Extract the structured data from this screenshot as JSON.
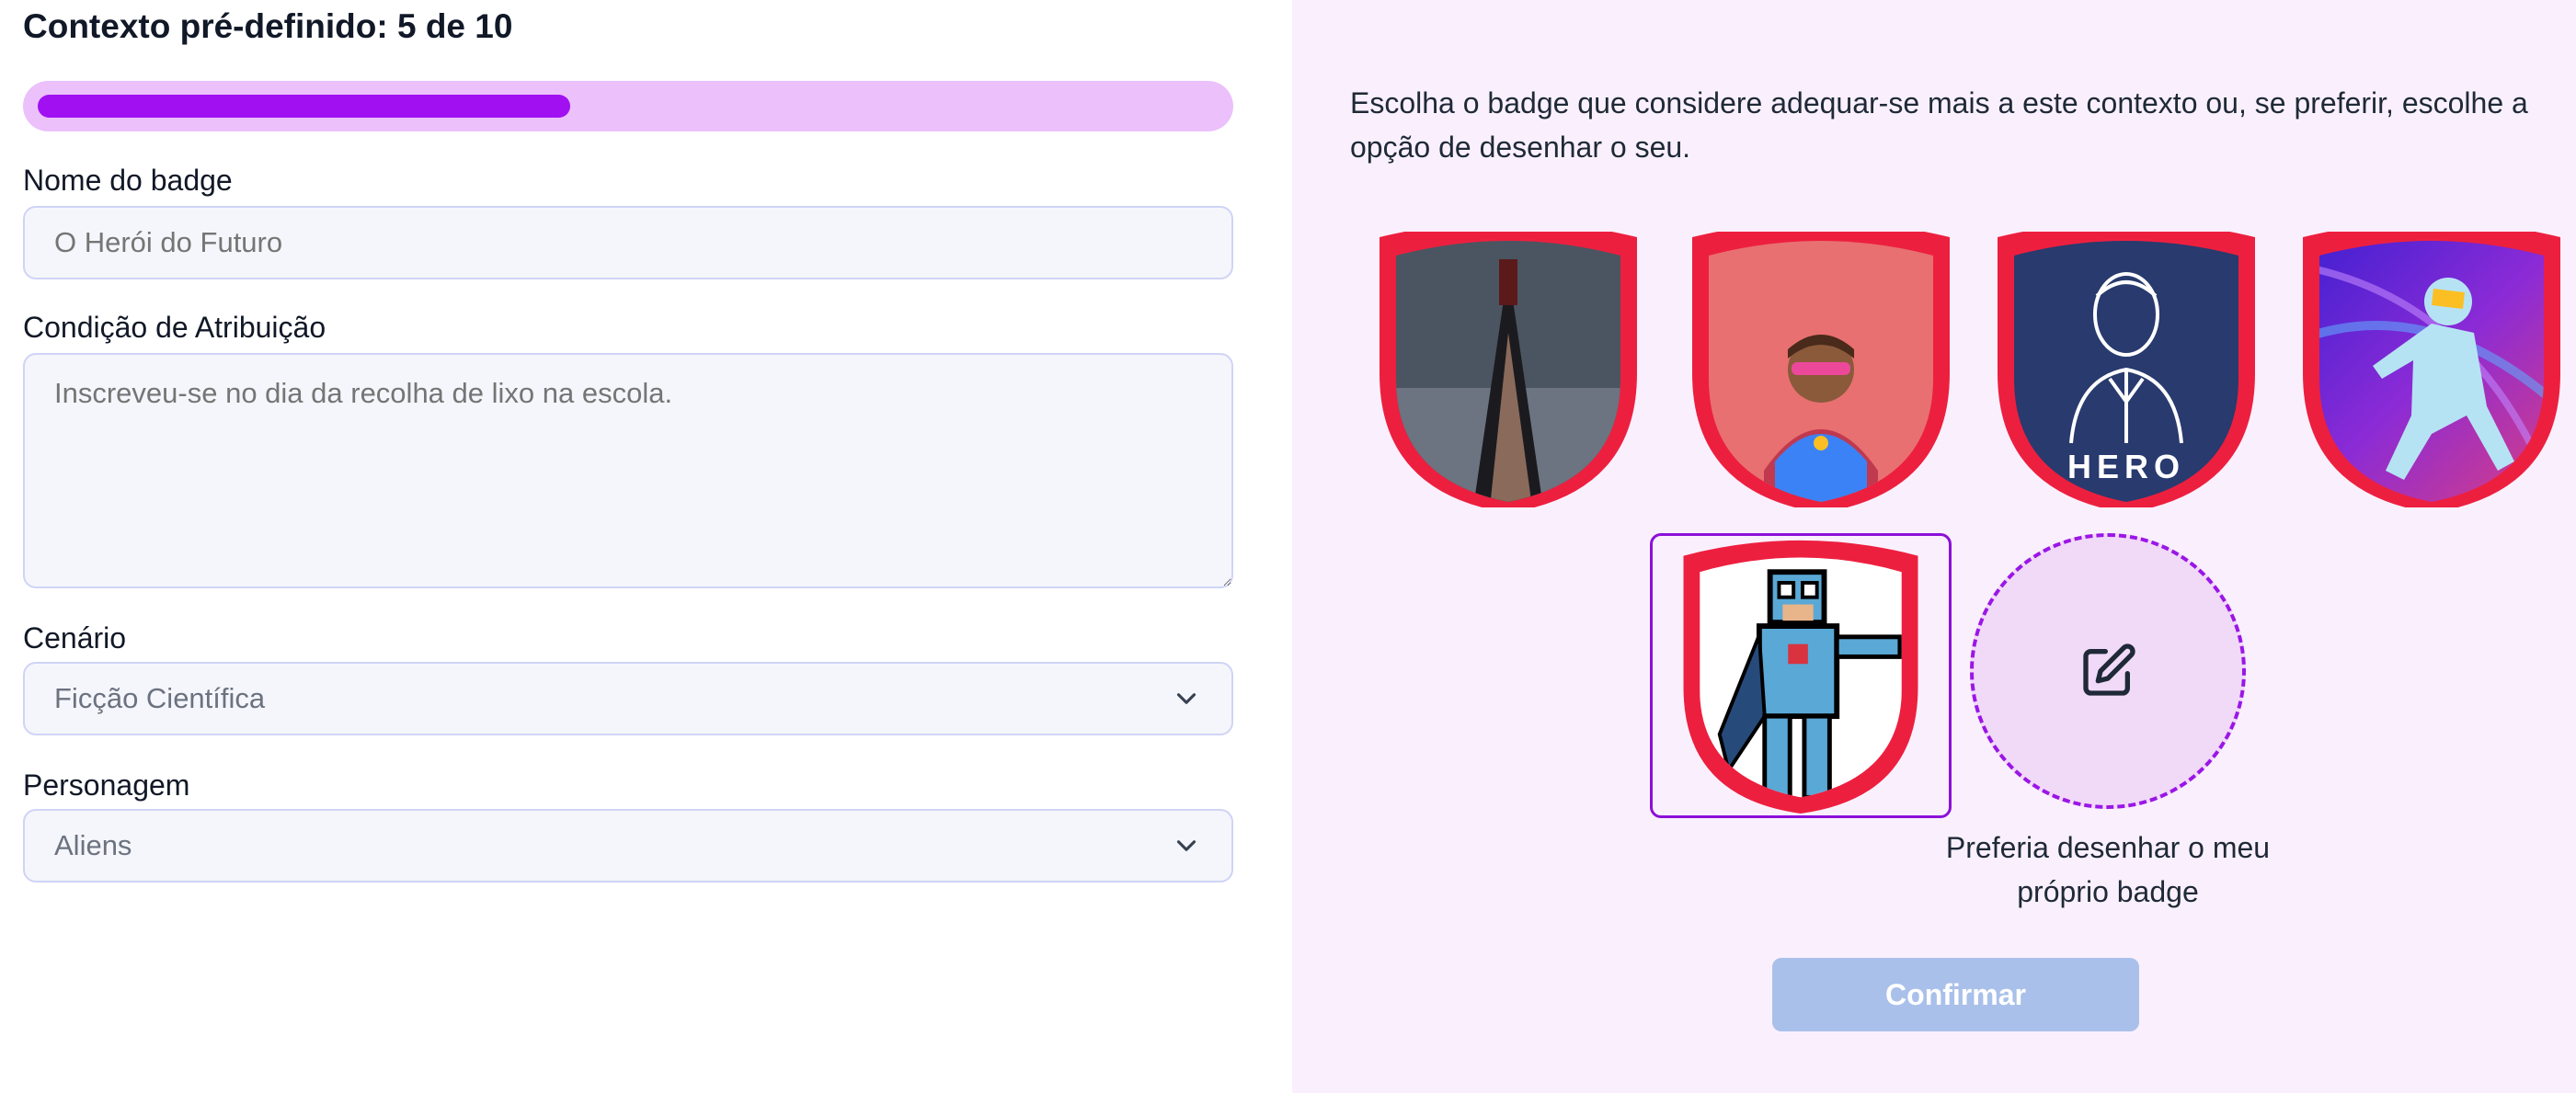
{
  "context": {
    "title": "Contexto pré-definido: 5 de 10",
    "progress_fraction": 0.5
  },
  "form": {
    "name_label": "Nome do badge",
    "name_placeholder": "O Herói do Futuro",
    "condition_label": "Condição de Atribuição",
    "condition_placeholder": "Inscreveu-se no dia da recolha de lixo na escola.",
    "scenario_label": "Cenário",
    "scenario_value": "Ficção Científica",
    "character_label": "Personagem",
    "character_value": "Aliens"
  },
  "picker": {
    "intro": "Escolha o badge que considere adequar-se mais a este contexto ou, se preferir, escolhe a opção de desenhar o seu.",
    "badges": [
      {
        "icon": "cloaked-figure-badge-icon",
        "selected": false
      },
      {
        "icon": "masked-hero-badge-icon",
        "selected": false
      },
      {
        "icon": "hero-line-art-badge-icon",
        "text": "HERO",
        "selected": false
      },
      {
        "icon": "space-suit-badge-icon",
        "selected": false
      },
      {
        "icon": "pixel-hero-badge-icon",
        "selected": true
      }
    ],
    "draw_icon": "edit-icon",
    "draw_caption": "Preferia desenhar o meu próprio badge",
    "confirm_label": "Confirmar"
  },
  "colors": {
    "accent": "#a010f0",
    "progress_track": "#ebc0fb",
    "badge_rim": "#ed1f3f",
    "panel_bg": "#faf0fd",
    "confirm_bg": "#a9c0ea"
  }
}
